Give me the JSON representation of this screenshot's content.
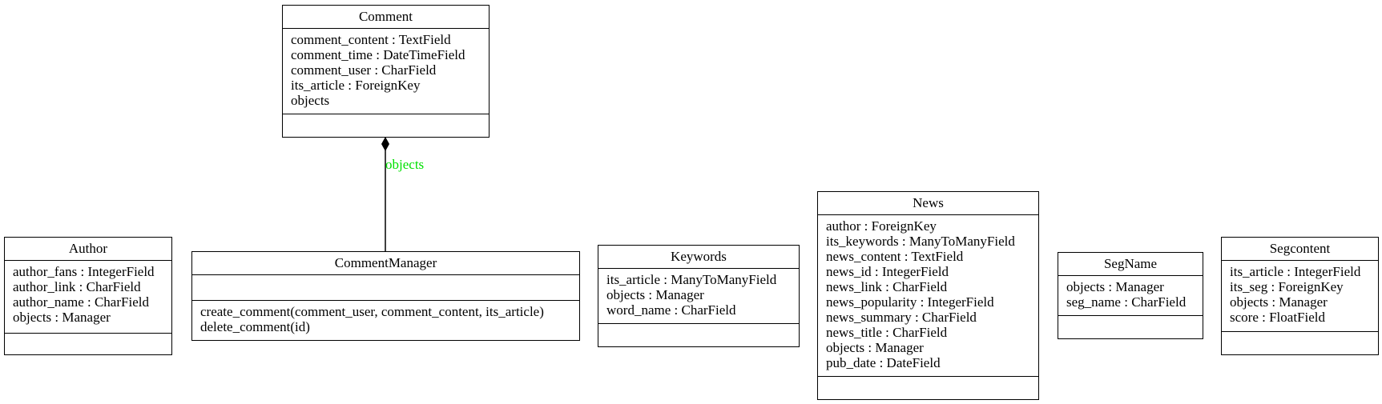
{
  "diagram": {
    "type": "uml-class-diagram",
    "classes": [
      {
        "id": "Comment",
        "name": "Comment",
        "attributes": [
          "comment_content : TextField",
          "comment_time : DateTimeField",
          "comment_user : CharField",
          "its_article : ForeignKey",
          "objects"
        ],
        "methods": []
      },
      {
        "id": "Author",
        "name": "Author",
        "attributes": [
          "author_fans : IntegerField",
          "author_link : CharField",
          "author_name : CharField",
          "objects : Manager"
        ],
        "methods": []
      },
      {
        "id": "CommentManager",
        "name": "CommentManager",
        "attributes": [],
        "methods": [
          "create_comment(comment_user, comment_content, its_article)",
          "delete_comment(id)"
        ]
      },
      {
        "id": "Keywords",
        "name": "Keywords",
        "attributes": [
          "its_article : ManyToManyField",
          "objects : Manager",
          "word_name : CharField"
        ],
        "methods": []
      },
      {
        "id": "News",
        "name": "News",
        "attributes": [
          "author : ForeignKey",
          "its_keywords : ManyToManyField",
          "news_content : TextField",
          "news_id : IntegerField",
          "news_link : CharField",
          "news_popularity : IntegerField",
          "news_summary : CharField",
          "news_title : CharField",
          "objects : Manager",
          "pub_date : DateField"
        ],
        "methods": []
      },
      {
        "id": "SegName",
        "name": "SegName",
        "attributes": [
          "objects : Manager",
          "seg_name : CharField"
        ],
        "methods": []
      },
      {
        "id": "Segcontent",
        "name": "Segcontent",
        "attributes": [
          "its_article : IntegerField",
          "its_seg : ForeignKey",
          "objects : Manager",
          "score : FloatField"
        ],
        "methods": []
      }
    ],
    "edges": [
      {
        "from": "CommentManager",
        "to": "Comment",
        "kind": "composition",
        "label": "objects",
        "label_color": "#00e000"
      }
    ]
  }
}
